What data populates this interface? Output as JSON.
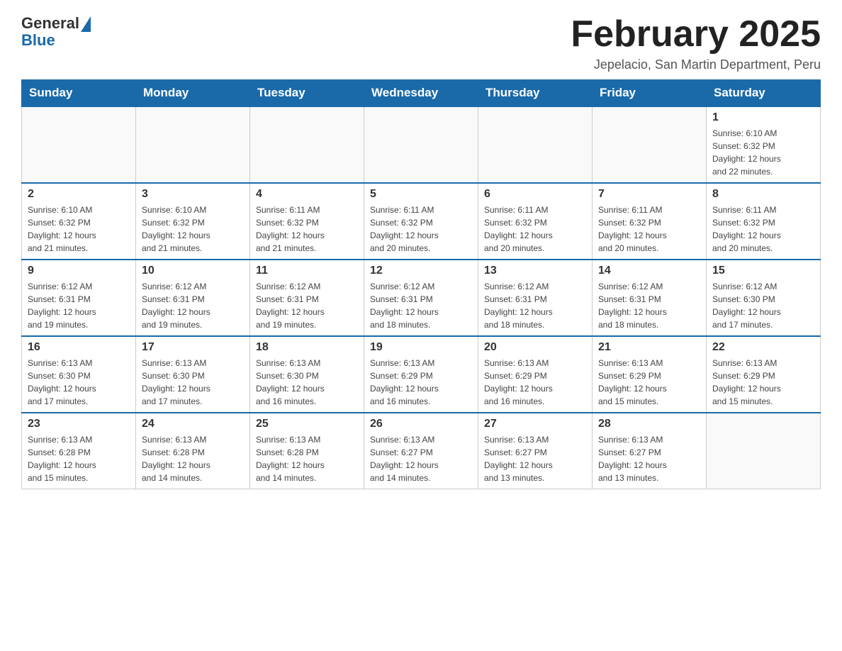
{
  "header": {
    "logo_general": "General",
    "logo_blue": "Blue",
    "title": "February 2025",
    "subtitle": "Jepelacio, San Martin Department, Peru"
  },
  "days_of_week": [
    "Sunday",
    "Monday",
    "Tuesday",
    "Wednesday",
    "Thursday",
    "Friday",
    "Saturday"
  ],
  "weeks": [
    {
      "days": [
        {
          "num": "",
          "info": ""
        },
        {
          "num": "",
          "info": ""
        },
        {
          "num": "",
          "info": ""
        },
        {
          "num": "",
          "info": ""
        },
        {
          "num": "",
          "info": ""
        },
        {
          "num": "",
          "info": ""
        },
        {
          "num": "1",
          "info": "Sunrise: 6:10 AM\nSunset: 6:32 PM\nDaylight: 12 hours\nand 22 minutes."
        }
      ]
    },
    {
      "days": [
        {
          "num": "2",
          "info": "Sunrise: 6:10 AM\nSunset: 6:32 PM\nDaylight: 12 hours\nand 21 minutes."
        },
        {
          "num": "3",
          "info": "Sunrise: 6:10 AM\nSunset: 6:32 PM\nDaylight: 12 hours\nand 21 minutes."
        },
        {
          "num": "4",
          "info": "Sunrise: 6:11 AM\nSunset: 6:32 PM\nDaylight: 12 hours\nand 21 minutes."
        },
        {
          "num": "5",
          "info": "Sunrise: 6:11 AM\nSunset: 6:32 PM\nDaylight: 12 hours\nand 20 minutes."
        },
        {
          "num": "6",
          "info": "Sunrise: 6:11 AM\nSunset: 6:32 PM\nDaylight: 12 hours\nand 20 minutes."
        },
        {
          "num": "7",
          "info": "Sunrise: 6:11 AM\nSunset: 6:32 PM\nDaylight: 12 hours\nand 20 minutes."
        },
        {
          "num": "8",
          "info": "Sunrise: 6:11 AM\nSunset: 6:32 PM\nDaylight: 12 hours\nand 20 minutes."
        }
      ]
    },
    {
      "days": [
        {
          "num": "9",
          "info": "Sunrise: 6:12 AM\nSunset: 6:31 PM\nDaylight: 12 hours\nand 19 minutes."
        },
        {
          "num": "10",
          "info": "Sunrise: 6:12 AM\nSunset: 6:31 PM\nDaylight: 12 hours\nand 19 minutes."
        },
        {
          "num": "11",
          "info": "Sunrise: 6:12 AM\nSunset: 6:31 PM\nDaylight: 12 hours\nand 19 minutes."
        },
        {
          "num": "12",
          "info": "Sunrise: 6:12 AM\nSunset: 6:31 PM\nDaylight: 12 hours\nand 18 minutes."
        },
        {
          "num": "13",
          "info": "Sunrise: 6:12 AM\nSunset: 6:31 PM\nDaylight: 12 hours\nand 18 minutes."
        },
        {
          "num": "14",
          "info": "Sunrise: 6:12 AM\nSunset: 6:31 PM\nDaylight: 12 hours\nand 18 minutes."
        },
        {
          "num": "15",
          "info": "Sunrise: 6:12 AM\nSunset: 6:30 PM\nDaylight: 12 hours\nand 17 minutes."
        }
      ]
    },
    {
      "days": [
        {
          "num": "16",
          "info": "Sunrise: 6:13 AM\nSunset: 6:30 PM\nDaylight: 12 hours\nand 17 minutes."
        },
        {
          "num": "17",
          "info": "Sunrise: 6:13 AM\nSunset: 6:30 PM\nDaylight: 12 hours\nand 17 minutes."
        },
        {
          "num": "18",
          "info": "Sunrise: 6:13 AM\nSunset: 6:30 PM\nDaylight: 12 hours\nand 16 minutes."
        },
        {
          "num": "19",
          "info": "Sunrise: 6:13 AM\nSunset: 6:29 PM\nDaylight: 12 hours\nand 16 minutes."
        },
        {
          "num": "20",
          "info": "Sunrise: 6:13 AM\nSunset: 6:29 PM\nDaylight: 12 hours\nand 16 minutes."
        },
        {
          "num": "21",
          "info": "Sunrise: 6:13 AM\nSunset: 6:29 PM\nDaylight: 12 hours\nand 15 minutes."
        },
        {
          "num": "22",
          "info": "Sunrise: 6:13 AM\nSunset: 6:29 PM\nDaylight: 12 hours\nand 15 minutes."
        }
      ]
    },
    {
      "days": [
        {
          "num": "23",
          "info": "Sunrise: 6:13 AM\nSunset: 6:28 PM\nDaylight: 12 hours\nand 15 minutes."
        },
        {
          "num": "24",
          "info": "Sunrise: 6:13 AM\nSunset: 6:28 PM\nDaylight: 12 hours\nand 14 minutes."
        },
        {
          "num": "25",
          "info": "Sunrise: 6:13 AM\nSunset: 6:28 PM\nDaylight: 12 hours\nand 14 minutes."
        },
        {
          "num": "26",
          "info": "Sunrise: 6:13 AM\nSunset: 6:27 PM\nDaylight: 12 hours\nand 14 minutes."
        },
        {
          "num": "27",
          "info": "Sunrise: 6:13 AM\nSunset: 6:27 PM\nDaylight: 12 hours\nand 13 minutes."
        },
        {
          "num": "28",
          "info": "Sunrise: 6:13 AM\nSunset: 6:27 PM\nDaylight: 12 hours\nand 13 minutes."
        },
        {
          "num": "",
          "info": ""
        }
      ]
    }
  ]
}
